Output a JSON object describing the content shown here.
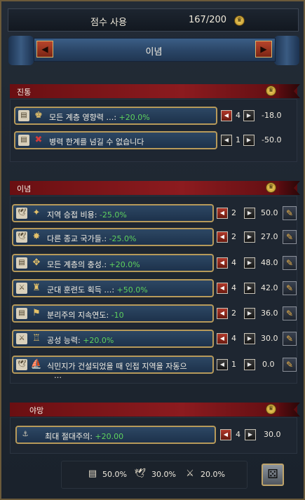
{
  "header": {
    "title": "점수 사용",
    "points": "167/200"
  },
  "banner": {
    "title": "이념"
  },
  "sections": {
    "tradition": {
      "label": "진통"
    },
    "ideas": {
      "label": "이념"
    },
    "ambition": {
      "label": "야망"
    }
  },
  "tradition_rows": [
    {
      "prefix": "모든 계층 영향력 …: ",
      "value": "+20.0%",
      "count": "4",
      "cost": "-18.0"
    },
    {
      "prefix": "병력 한계를 넘길 수 없습니다",
      "value": "",
      "count": "1",
      "cost": "-50.0"
    }
  ],
  "idea_rows": [
    {
      "prefix": "지역 승접 비용: ",
      "value": "-25.0%",
      "count": "2",
      "cost": "50.0"
    },
    {
      "prefix": "다른 종교 국가들.: ",
      "value": "-25.0%",
      "count": "2",
      "cost": "27.0"
    },
    {
      "prefix": "모든 계층의 충성.: ",
      "value": "+20.0%",
      "count": "4",
      "cost": "48.0"
    },
    {
      "prefix": "군대 훈련도 획득 …: ",
      "value": "+50.0%",
      "count": "4",
      "cost": "42.0"
    },
    {
      "prefix": "분리주의 지속연도: ",
      "value": "-10",
      "count": "2",
      "cost": "36.0"
    },
    {
      "prefix": "공성 능력: ",
      "value": "+20.0%",
      "count": "4",
      "cost": "30.0"
    },
    {
      "prefix": "식민지가 건설되었을 때 인접 지역을 자동으",
      "value": "",
      "count": "1",
      "cost": "0.0"
    }
  ],
  "idea_row_extra": "…",
  "ambition_rows": [
    {
      "prefix": "최대 절대주의: ",
      "value": "+20.00",
      "count": "4",
      "cost": "30.0"
    }
  ],
  "footer": {
    "admin": "50.0%",
    "diplo": "30.0%",
    "military": "20.0%"
  },
  "icons": {
    "crown": "crown-icon",
    "scroll": "scroll-icon",
    "dove": "dove-icon",
    "swords": "crossed-swords-icon",
    "dice": "dice-icon",
    "pen": "pencil-icon"
  },
  "colors": {
    "green": "#5ed15e",
    "gold": "#b79a5a",
    "red": "#8c1b1f"
  }
}
